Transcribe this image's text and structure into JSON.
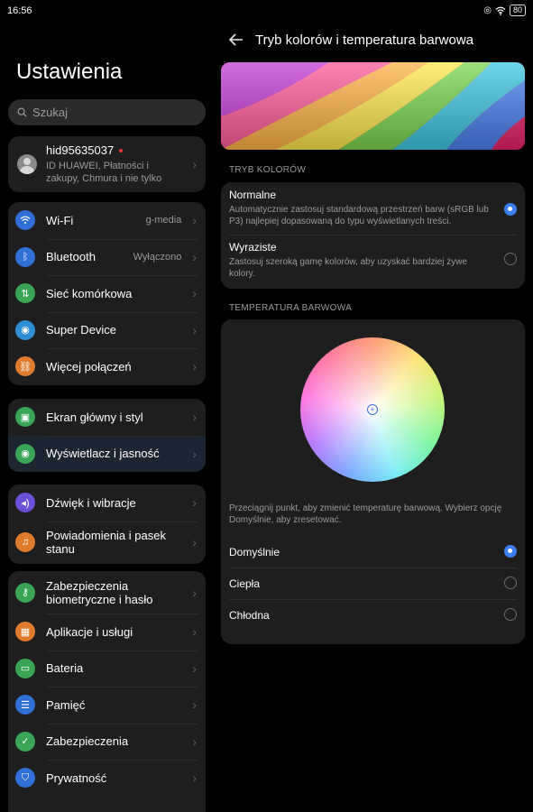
{
  "status": {
    "time": "16:56",
    "battery": "80"
  },
  "left": {
    "title": "Ustawienia",
    "search_placeholder": "Szukaj",
    "account": {
      "name": "hid95635037",
      "subtitle": "ID HUAWEI, Płatności i zakupy, Chmura i nie tylko"
    },
    "group1": [
      {
        "label": "Wi-Fi",
        "value": "g-media",
        "icon": "wifi-icon",
        "color": "#2f6fd6"
      },
      {
        "label": "Bluetooth",
        "value": "Wyłączono",
        "icon": "bluetooth-icon",
        "color": "#2f6fd6"
      },
      {
        "label": "Sieć komórkowa",
        "value": "",
        "icon": "cellular-icon",
        "color": "#3aa655"
      },
      {
        "label": "Super Device",
        "value": "",
        "icon": "super-device-icon",
        "color": "#2f8fd6"
      },
      {
        "label": "Więcej połączeń",
        "value": "",
        "icon": "link-icon",
        "color": "#e07b2e"
      }
    ],
    "group2": [
      {
        "label": "Ekran główny i styl",
        "icon": "home-screen-icon",
        "color": "#3aa655"
      },
      {
        "label": "Wyświetlacz i jasność",
        "icon": "eye-icon",
        "color": "#3aa655"
      }
    ],
    "group3": [
      {
        "label": "Dźwięk i wibracje",
        "icon": "sound-icon",
        "color": "#6b4fd6"
      },
      {
        "label": "Powiadomienia i pasek stanu",
        "icon": "bell-icon",
        "color": "#e07b2e"
      }
    ],
    "group4": [
      {
        "label": "Zabezpieczenia biometryczne i hasło",
        "icon": "key-icon",
        "color": "#3aa655"
      },
      {
        "label": "Aplikacje i usługi",
        "icon": "apps-icon",
        "color": "#e07b2e"
      },
      {
        "label": "Bateria",
        "icon": "battery-icon",
        "color": "#3aa655"
      },
      {
        "label": "Pamięć",
        "icon": "storage-icon",
        "color": "#2f6fd6"
      },
      {
        "label": "Zabezpieczenia",
        "icon": "shield-icon",
        "color": "#3aa655"
      },
      {
        "label": "Prywatność",
        "icon": "privacy-icon",
        "color": "#2f6fd6"
      }
    ]
  },
  "right": {
    "title": "Tryb kolorów i temperatura barwowa",
    "color_mode_label": "TRYB KOLORÓW",
    "modes": [
      {
        "title": "Normalne",
        "desc": "Automatycznie zastosuj standardową przestrzeń barw (sRGB lub P3) najlepiej dopasowaną do typu wyświetlanych treści.",
        "selected": true
      },
      {
        "title": "Wyraziste",
        "desc": "Zastosuj szeroką gamę kolorów, aby uzyskać bardziej żywe kolory.",
        "selected": false
      }
    ],
    "temperature_label": "TEMPERATURA BARWOWA",
    "hint": "Przeciągnij punkt, aby zmienić temperaturę barwową. Wybierz opcję Domyślnie, aby zresetować.",
    "temps": [
      {
        "label": "Domyślnie",
        "selected": true
      },
      {
        "label": "Ciepła",
        "selected": false
      },
      {
        "label": "Chłodna",
        "selected": false
      }
    ]
  }
}
